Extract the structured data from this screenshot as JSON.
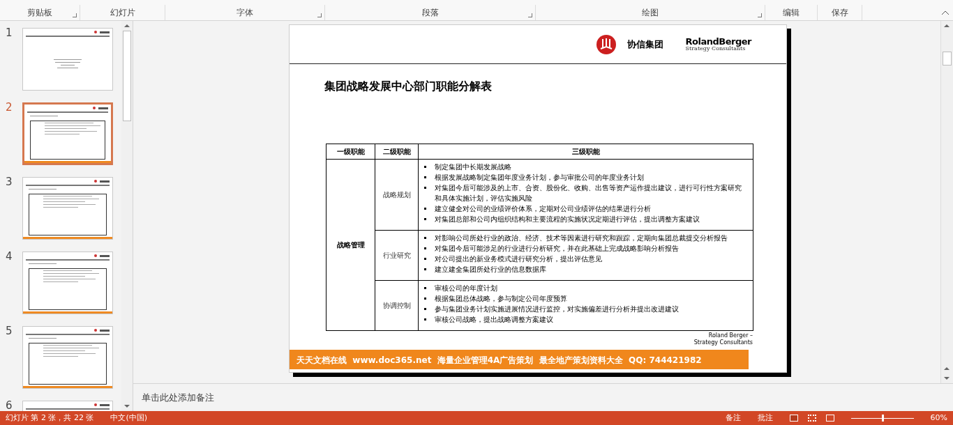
{
  "ribbon": {
    "groups": [
      {
        "label": "剪贴板",
        "launcher": true
      },
      {
        "label": "幻灯片",
        "launcher": false
      },
      {
        "label": "字体",
        "launcher": true
      },
      {
        "label": "段落",
        "launcher": true
      },
      {
        "label": "绘图",
        "launcher": true
      },
      {
        "label": "编辑",
        "launcher": false
      },
      {
        "label": "保存",
        "launcher": false
      }
    ]
  },
  "thumbnails": [
    {
      "number": "1",
      "kind": "cover",
      "selected": false
    },
    {
      "number": "2",
      "kind": "table",
      "selected": true
    },
    {
      "number": "3",
      "kind": "table",
      "selected": false
    },
    {
      "number": "4",
      "kind": "table",
      "selected": false
    },
    {
      "number": "5",
      "kind": "table",
      "selected": false
    },
    {
      "number": "6",
      "kind": "table",
      "selected": false
    }
  ],
  "slide": {
    "company": "协信集团",
    "consultant_name": "RolandBerger",
    "consultant_tagline": "Strategy Consultants",
    "title": "集团战略发展中心部门职能分解表",
    "table": {
      "columns": [
        "一级职能",
        "二级职能",
        "三级职能"
      ],
      "rows": [
        {
          "level1": "战略管理",
          "groups": [
            {
              "level2": "战略规划",
              "items": [
                "制定集团中长期发展战略",
                "根据发展战略制定集团年度业务计划，参与审批公司的年度业务计划",
                "对集团今后可能涉及的上市、合资、股份化、收购、出售等资产运作提出建议，进行可行性方案研究和具体实施计划，评估实施风险",
                "建立健全对公司的业绩评价体系，定期对公司业绩评估的结果进行分析",
                "对集团总部和公司内组织结构和主要流程的实施状况定期进行评估，提出调整方案建议"
              ]
            },
            {
              "level2": "行业研究",
              "items": [
                "对影响公司所处行业的政治、经济、技术等因素进行研究和跟踪，定期向集团总裁提交分析报告",
                "对集团今后可能涉足的行业进行分析研究，并在此基础上完成战略影响分析报告",
                "对公司提出的新业务模式进行研究分析，提出评估意见",
                "建立建全集团所处行业的信息数据库"
              ]
            },
            {
              "level2": "协调控制",
              "items": [
                "审核公司的年度计划",
                "根据集团总体战略，参与制定公司年度预算",
                "参与集团业务计划实施进展情况进行监控，对实施偏差进行分析并提出改进建议",
                "审核公司战略，提出战略调整方案建议"
              ]
            }
          ]
        }
      ]
    },
    "footer": "Roland Berger – Strategy Consultants",
    "banner": "天天文档在线  www.doc365.net  海量企业管理4A广告策划  最全地产策划资料大全  QQ: 744421982"
  },
  "notes": {
    "placeholder": "单击此处添加备注"
  },
  "status_bar": {
    "slide_info": "幻灯片 第 2 张，共 22 张",
    "language": "中文(中国)",
    "notes": "备注",
    "comments": "批注",
    "zoom_slider": {
      "level": 0.5
    },
    "zoom": "60%"
  }
}
